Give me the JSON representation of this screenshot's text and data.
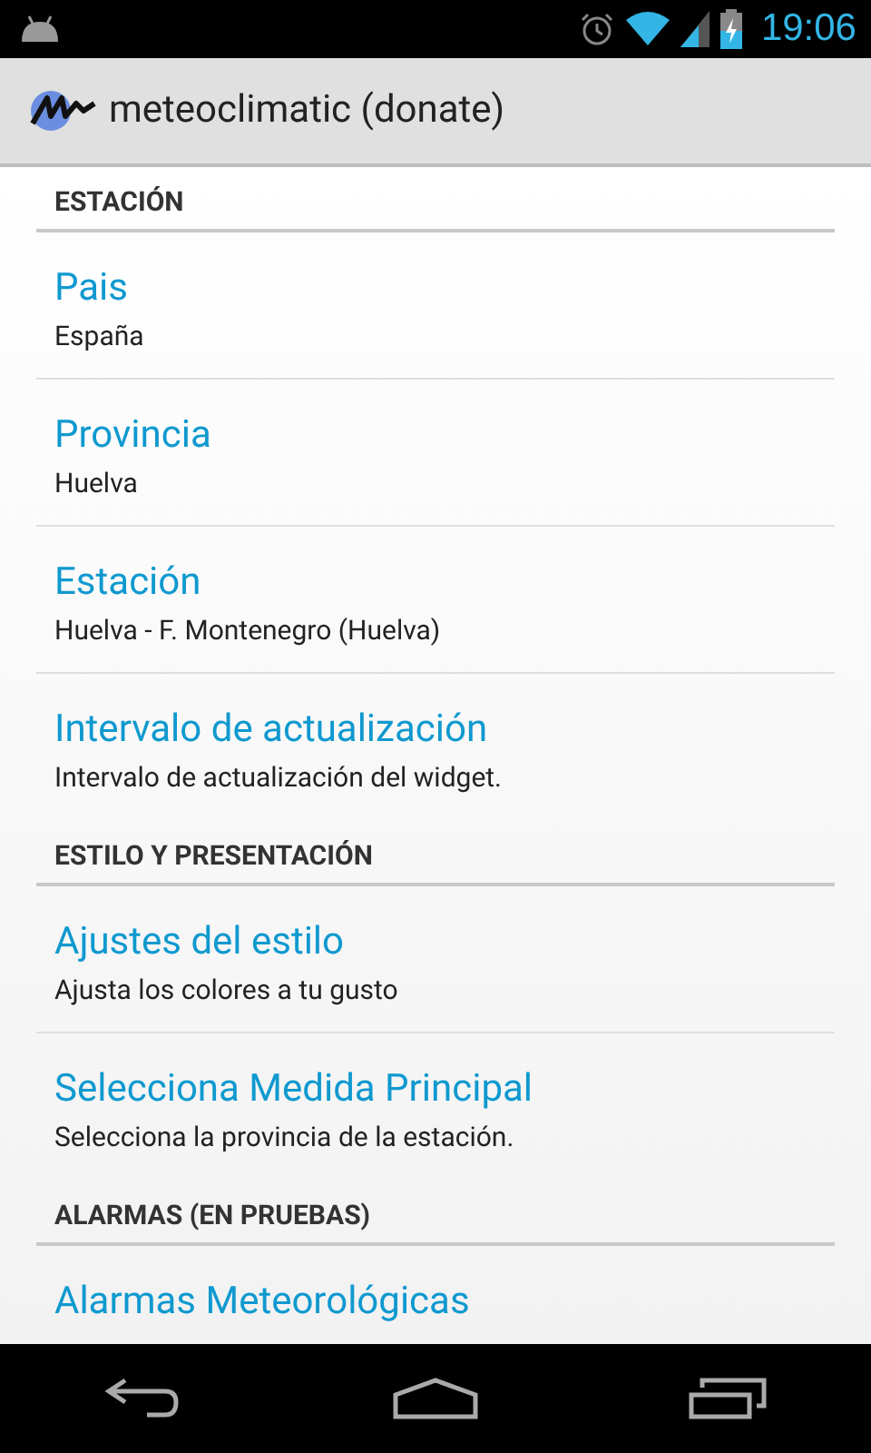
{
  "status_bar": {
    "time": "19:06"
  },
  "action_bar": {
    "title": "meteoclimatic (donate)"
  },
  "sections": [
    {
      "title": "ESTACIÓN",
      "items": [
        {
          "title": "Pais",
          "summary": "España"
        },
        {
          "title": "Provincia",
          "summary": "Huelva"
        },
        {
          "title": "Estación",
          "summary": "Huelva - F. Montenegro (Huelva)"
        },
        {
          "title": "Intervalo de actualización",
          "summary": "Intervalo de actualización del widget."
        }
      ]
    },
    {
      "title": "ESTILO Y PRESENTACIÓN",
      "items": [
        {
          "title": "Ajustes del estilo",
          "summary": "Ajusta los colores a tu gusto"
        },
        {
          "title": "Selecciona Medida Principal",
          "summary": "Selecciona la provincia de la estación."
        }
      ]
    },
    {
      "title": "ALARMAS (EN PRUEBAS)",
      "items": [
        {
          "title": "Alarmas Meteorológicas"
        }
      ]
    }
  ]
}
